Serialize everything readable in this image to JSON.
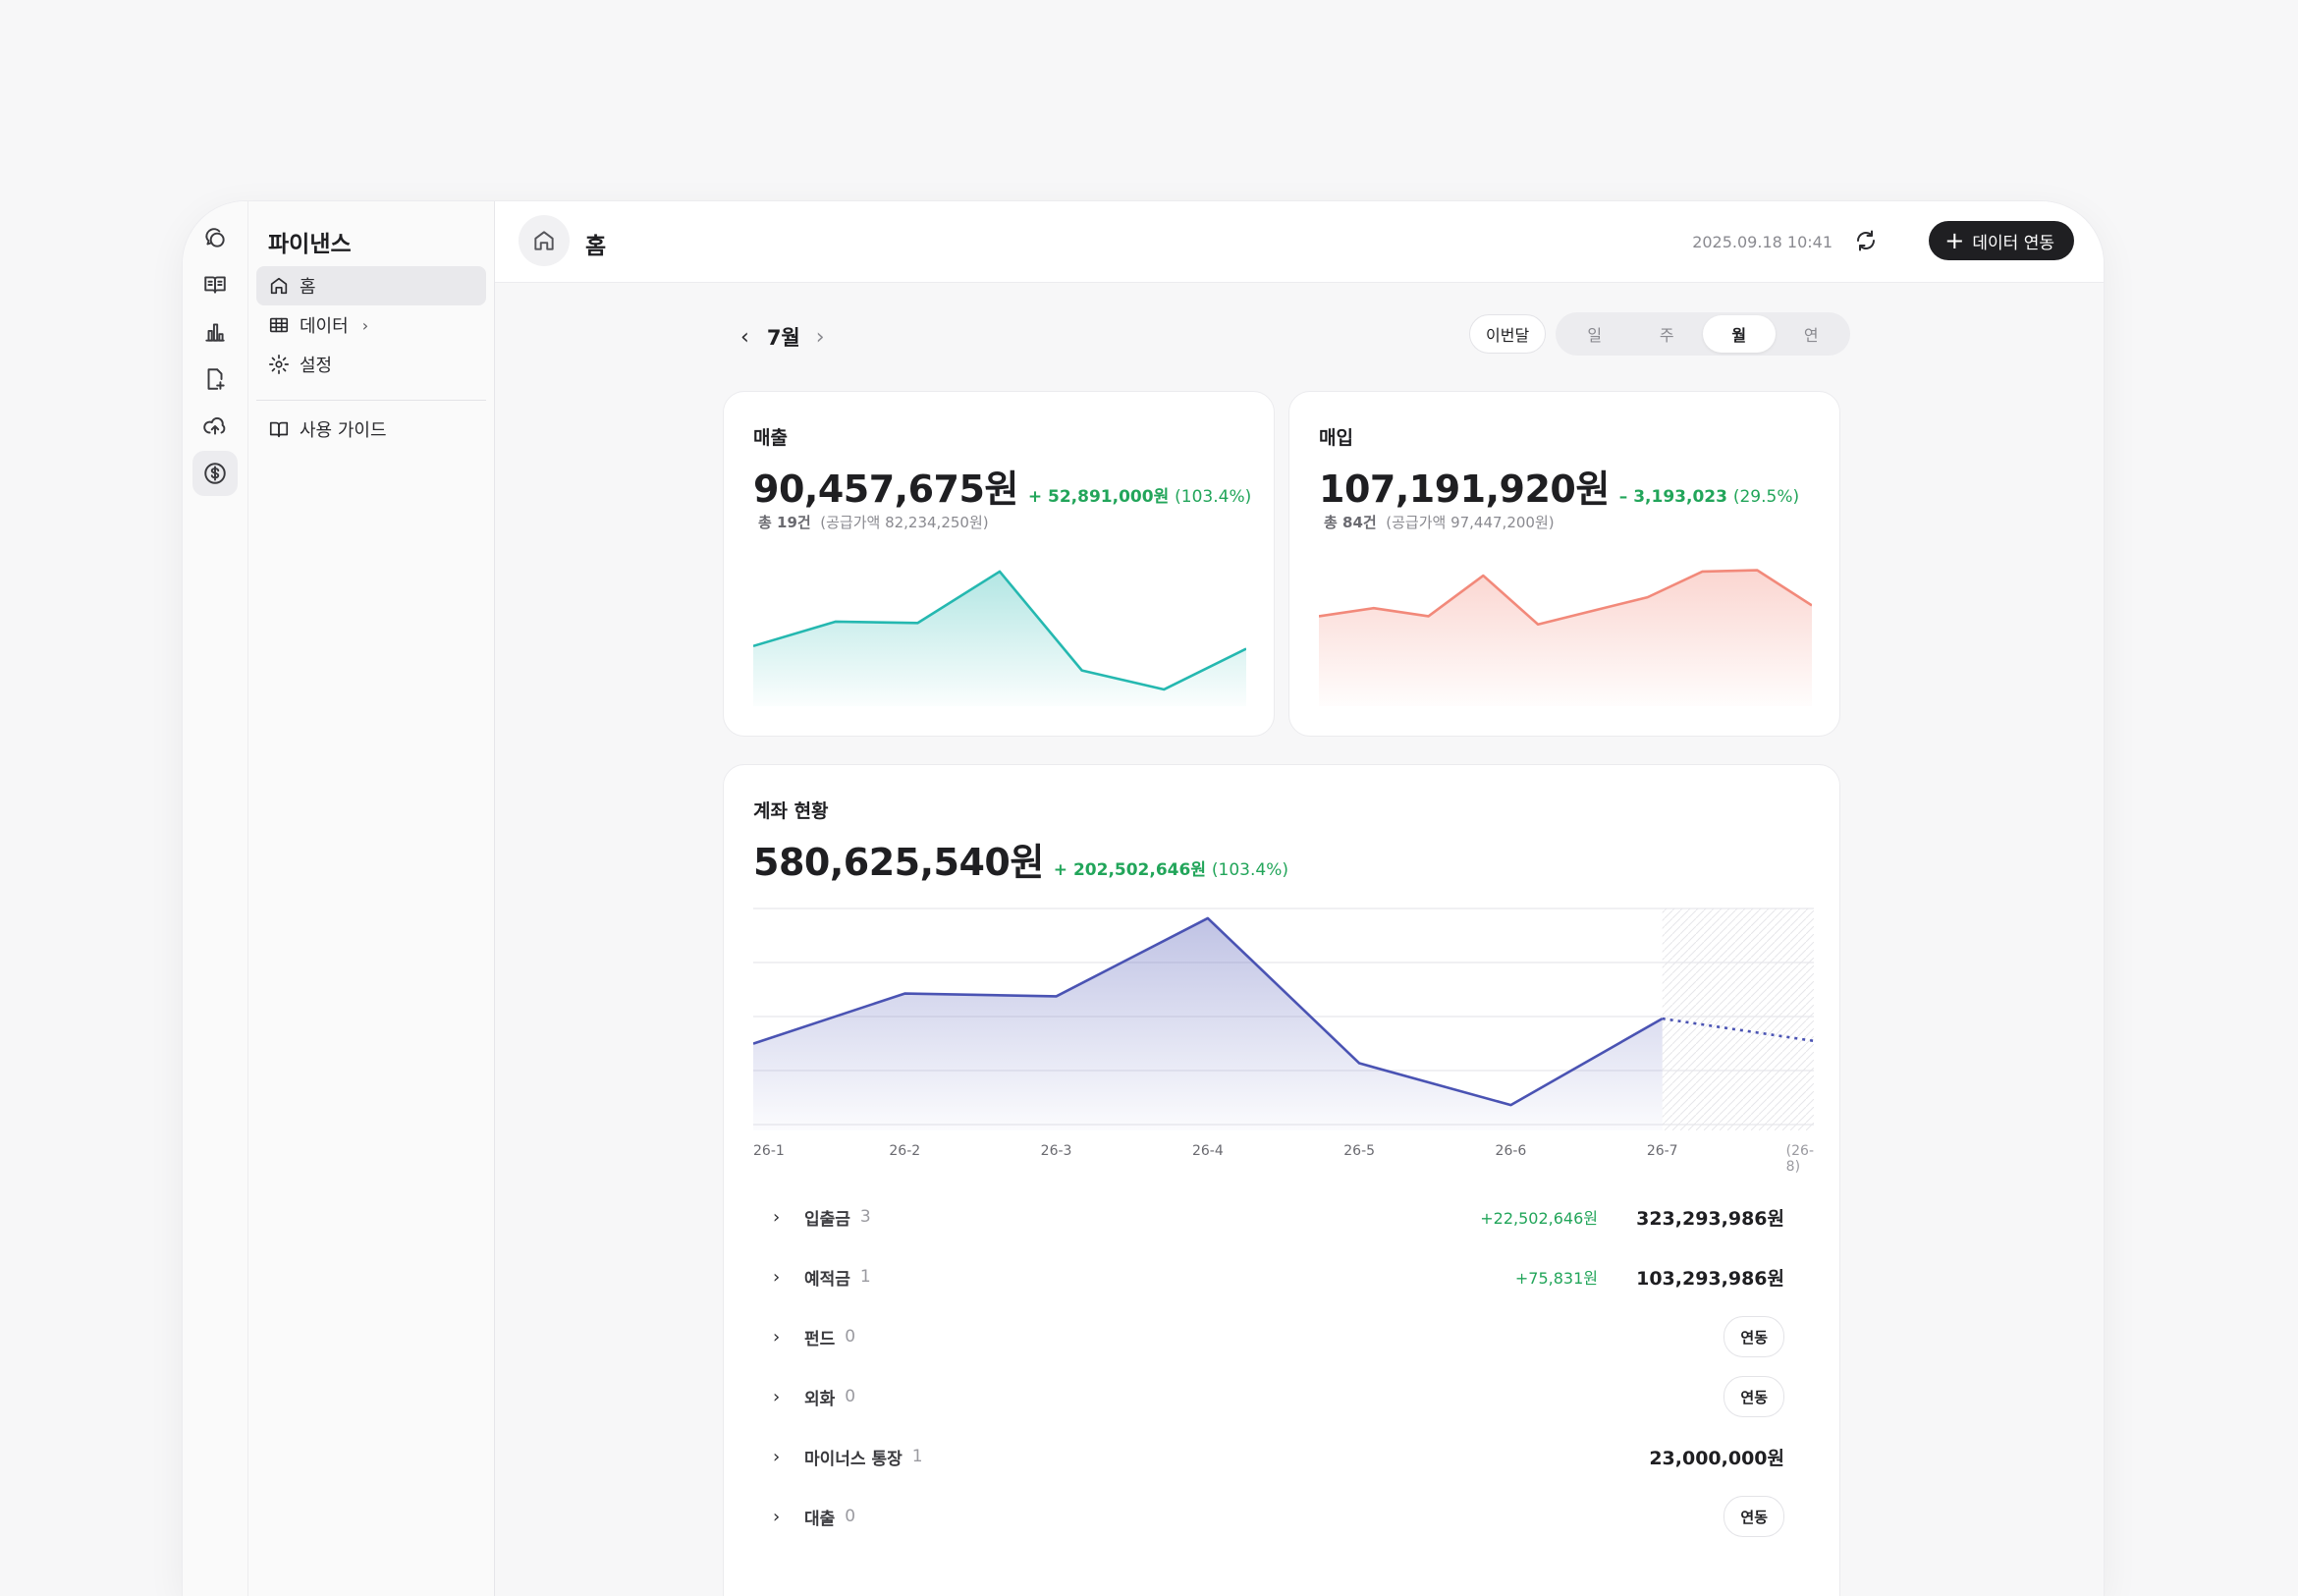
{
  "sidebar": {
    "title": "파이낸스",
    "items": [
      {
        "label": "홈"
      },
      {
        "label": "데이터"
      },
      {
        "label": "설정"
      }
    ],
    "guide_label": "사용 가이드"
  },
  "header": {
    "title": "홈",
    "timestamp": "2025.09.18 10:41",
    "connect_label": "데이터 연동"
  },
  "period": {
    "month_label": "7월",
    "this_month_label": "이번달",
    "segments": [
      "일",
      "주",
      "월",
      "연"
    ],
    "active_segment": "월"
  },
  "sales": {
    "label": "매출",
    "amount": "90,457,675원",
    "delta": "+ 52,891,000원",
    "delta_pct": "(103.4%)",
    "count_label": "총 19건",
    "supply": "(공급가액 82,234,250원)",
    "color": "#25b8b0"
  },
  "purchase": {
    "label": "매입",
    "amount": "107,191,920원",
    "delta": "– 3,193,023",
    "delta_pct": "(29.5%)",
    "count_label": "총 84건",
    "supply": "(공급가액 97,447,200원)",
    "color": "#f2897a"
  },
  "account": {
    "label": "계좌 현황",
    "amount": "580,625,540원",
    "delta": "+ 202,502,646원",
    "delta_pct": "(103.4%)",
    "color": "#4a53b3",
    "rows": [
      {
        "name": "입출금",
        "count": "3",
        "delta": "+22,502,646원",
        "total": "323,293,986원"
      },
      {
        "name": "예적금",
        "count": "1",
        "delta": "+75,831원",
        "total": "103,293,986원"
      },
      {
        "name": "펀드",
        "count": "0",
        "action": "연동"
      },
      {
        "name": "외화",
        "count": "0",
        "action": "연동"
      },
      {
        "name": "마이너스 통장",
        "count": "1",
        "total": "23,000,000원"
      },
      {
        "name": "대출",
        "count": "0",
        "action": "연동"
      }
    ]
  },
  "chart_data": [
    {
      "type": "area",
      "name": "매출",
      "values": [
        40,
        58,
        57,
        95,
        22,
        8,
        38
      ],
      "ylim": [
        0,
        100
      ]
    },
    {
      "type": "area",
      "name": "매입",
      "values": [
        62,
        68,
        62,
        92,
        56,
        66,
        76,
        95,
        96,
        70
      ],
      "ylim": [
        0,
        100
      ]
    },
    {
      "type": "area",
      "name": "계좌 현황",
      "x": [
        "26-1",
        "26-2",
        "26-3",
        "26-4",
        "26-5",
        "26-6",
        "26-7",
        "(26-8)"
      ],
      "values": [
        58,
        94,
        92,
        148,
        44,
        14,
        76,
        60
      ],
      "forecast_from_index": 6,
      "ylim": [
        0,
        155
      ],
      "grid": true
    }
  ]
}
